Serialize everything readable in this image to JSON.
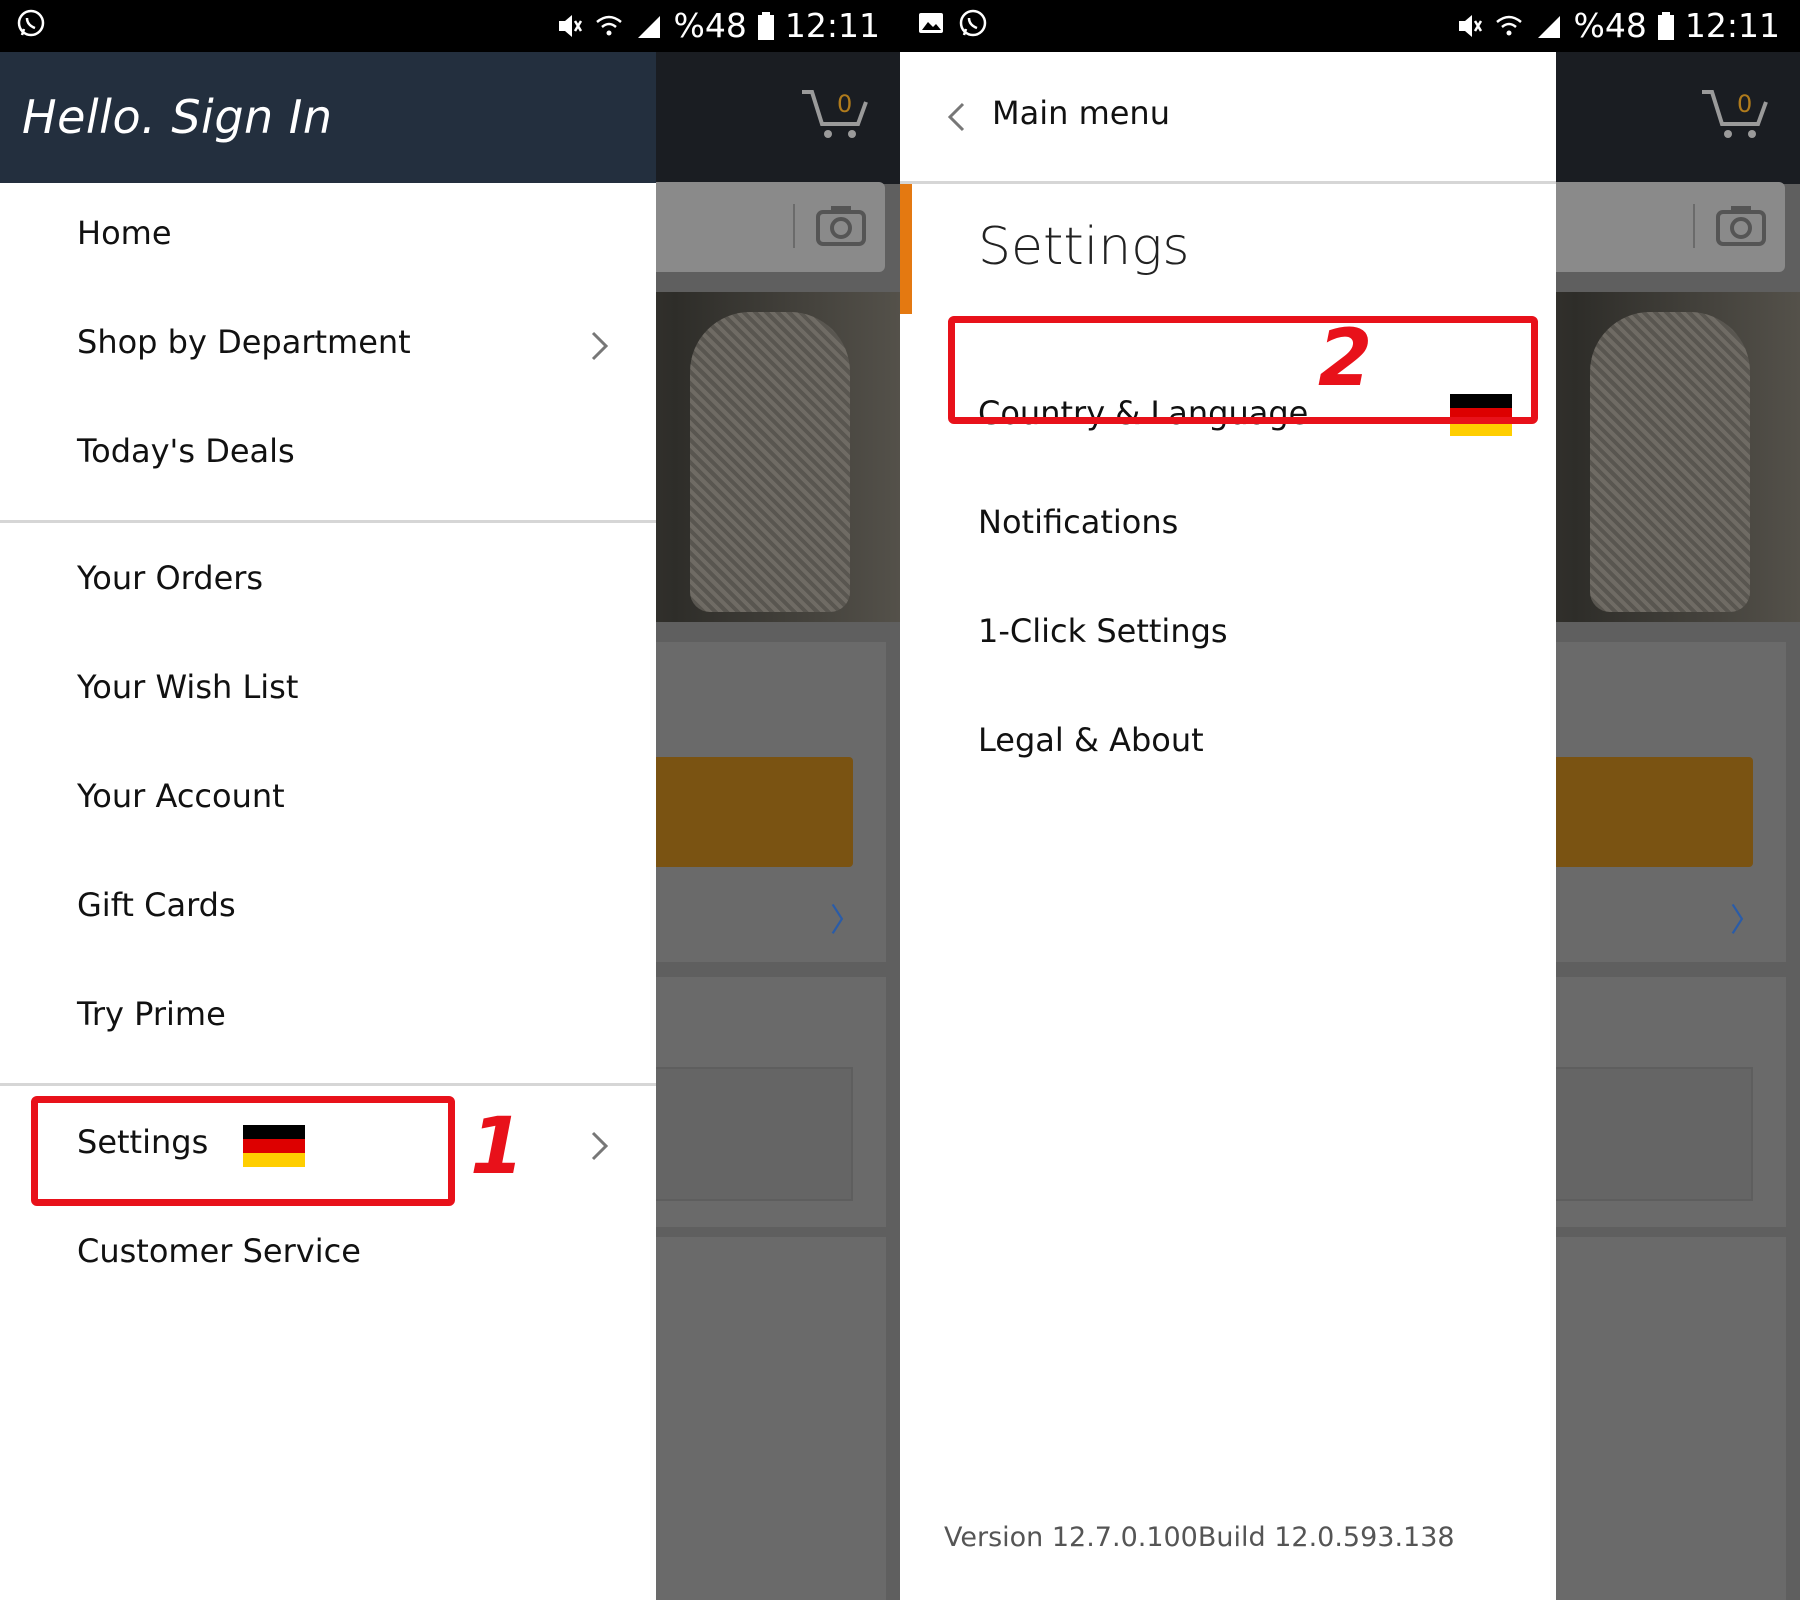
{
  "status_bar": {
    "battery": "%48",
    "time": "12:11"
  },
  "background_app": {
    "cart_count": "0",
    "link_chevron": "〉"
  },
  "left_panel": {
    "header": "Hello. Sign In",
    "menu": [
      {
        "label": "Home",
        "has_chevron": false
      },
      {
        "label": "Shop by Department",
        "has_chevron": true
      },
      {
        "label": "Today's Deals",
        "has_chevron": false
      },
      {
        "label": "Your Orders",
        "has_chevron": false
      },
      {
        "label": "Your Wish List",
        "has_chevron": false
      },
      {
        "label": "Your Account",
        "has_chevron": false
      },
      {
        "label": "Gift Cards",
        "has_chevron": false
      },
      {
        "label": "Try Prime",
        "has_chevron": false
      },
      {
        "label": "Settings",
        "has_chevron": true,
        "flag": "germany"
      },
      {
        "label": "Customer Service",
        "has_chevron": false
      }
    ],
    "annotation_number": "1"
  },
  "right_panel": {
    "back_label": "Main menu",
    "title": "Settings",
    "items": [
      {
        "label": "Country & Language",
        "flag": "germany"
      },
      {
        "label": "Notifications"
      },
      {
        "label": "1-Click Settings"
      },
      {
        "label": "Legal & About"
      }
    ],
    "annotation_number": "2",
    "version": "Version 12.7.0.100Build 12.0.593.138"
  },
  "colors": {
    "drawer_header": "#232f3e",
    "accent": "#e47911",
    "annotation": "#e8111a"
  }
}
